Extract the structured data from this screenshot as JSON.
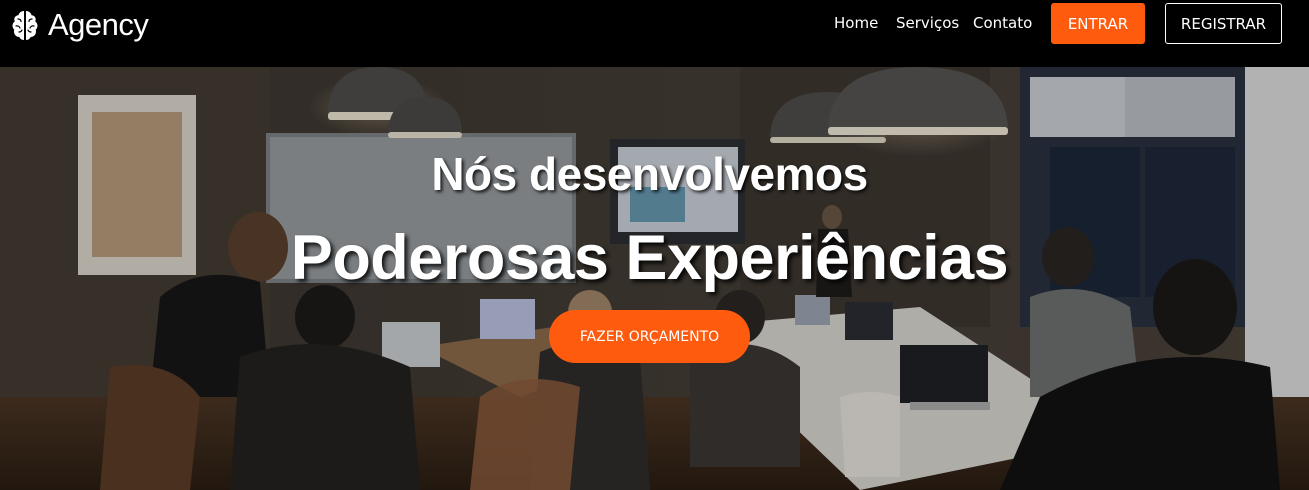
{
  "navbar": {
    "brand": {
      "icon": "brain-icon",
      "name": "Agency"
    },
    "links": [
      "Home",
      "Serviços",
      "Contato"
    ],
    "login_label": "ENTRAR",
    "register_label": "REGISTRAR"
  },
  "hero": {
    "subtitle": "Nós desenvolvemos",
    "title": "Poderosas Experiências",
    "cta_label": "FAZER ORÇAMENTO",
    "background": "office-photo-dimmed"
  },
  "colors": {
    "accent": "#ff5b0f",
    "navbar_bg": "#000000",
    "text": "#ffffff"
  }
}
